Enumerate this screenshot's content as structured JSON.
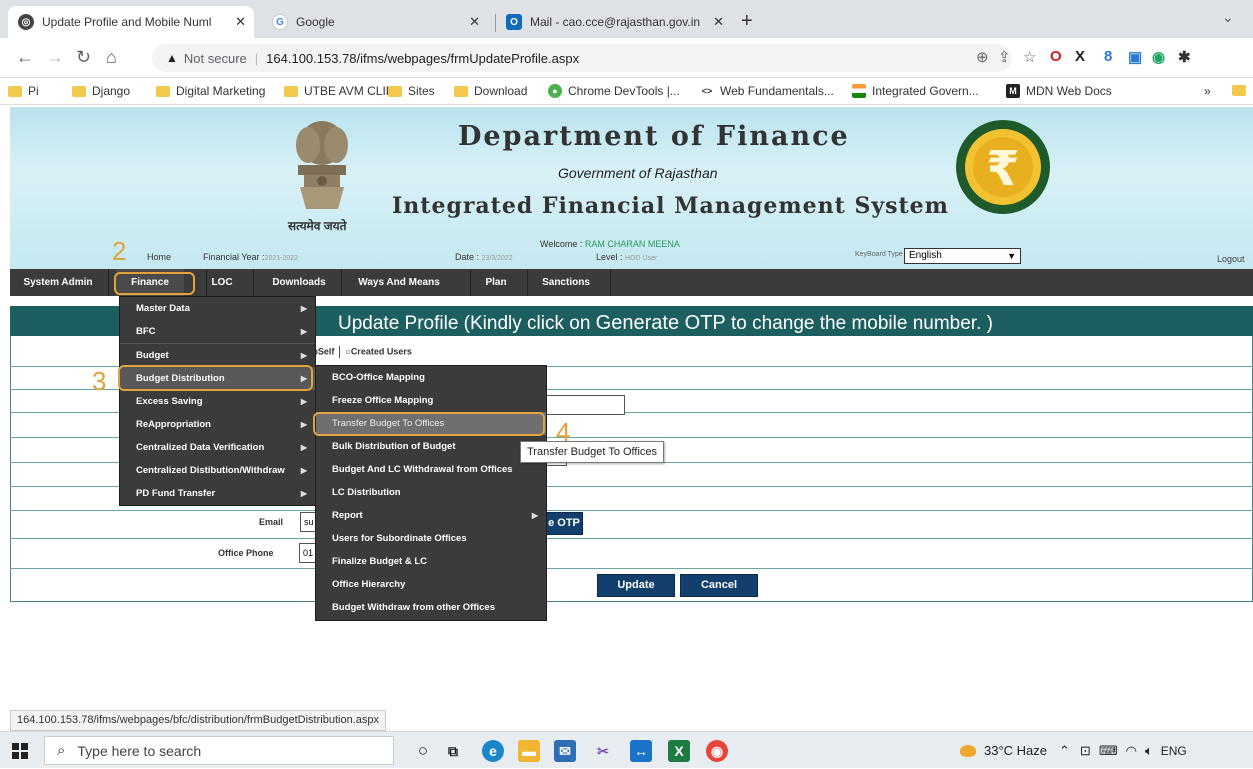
{
  "browser": {
    "tabs": [
      {
        "title": "Update Profile and Mobile Numl",
        "active": true
      },
      {
        "title": "Google",
        "active": false
      },
      {
        "title": "Mail - cao.cce@rajasthan.gov.in",
        "active": false
      }
    ],
    "url": "164.100.153.78/ifms/webpages/frmUpdateProfile.aspx",
    "security_label": "Not secure",
    "bookmarks": [
      "Pi",
      "Django",
      "Digital Marketing",
      "UTBE AVM CLIP",
      "Sites",
      "Download",
      "Chrome DevTools |...",
      "Web Fundamentals...",
      "Integrated Govern...",
      "MDN Web Docs"
    ],
    "bookmarks_more": "»",
    "status_url": "164.100.153.78/ifms/webpages/bfc/distribution/frmBudgetDistribution.aspx"
  },
  "header": {
    "title": "Department of Finance",
    "subtitle": "Government of Rajasthan",
    "system_name": "Integrated Financial Management System",
    "emblem_motto": "सत्यमेव जयते",
    "welcome_label": "Welcome :",
    "welcome_user": "RAM CHARAN MEENA",
    "home_label": "Home",
    "fy_label": "Financial Year :",
    "fy_value": "2021-2022",
    "date_label": "Date :",
    "date_value": "23/3/2022",
    "level_label": "Level :",
    "level_value": "HOD User",
    "keyboard_label": "KeyBoard Type :",
    "keyboard_value": "English",
    "logout": "Logout"
  },
  "nav": {
    "items": [
      "System Admin",
      "Finance",
      "LOC",
      "Downloads",
      "Ways And Means",
      "Plan",
      "Sanctions"
    ]
  },
  "finance_menu": {
    "items": [
      "Master Data",
      "BFC",
      "Budget",
      "Budget Distribution",
      "Excess Saving",
      "ReAppropriation",
      "Centralized Data Verification",
      "Centralized Distibution/Withdraw",
      "PD Fund Transfer"
    ]
  },
  "budget_dist_menu": {
    "items": [
      "BCO-Office Mapping",
      "Freeze Office Mapping",
      "Transfer Budget To Offices",
      "Bulk Distribution of Budget",
      "Budget And LC Withdrawal from Offices",
      "LC Distribution",
      "Report",
      "Users for Subordinate Offices",
      "Finalize Budget & LC",
      "Office Hierarchy",
      "Budget Withdraw from other Offices"
    ]
  },
  "tooltip": "Transfer Budget To Offices",
  "annotations": {
    "step2": "2",
    "step3": "3",
    "step4": "4"
  },
  "form": {
    "heading_prefix": "Update Profile (Kindly click on ",
    "heading_emph": "Generate OTP",
    "heading_suffix": " to change the mobile number. )",
    "radio_self": "Self",
    "radio_created": "Created Users",
    "email_label": "Email",
    "email_value": "su",
    "phone_label": "Office Phone",
    "phone_value": "01",
    "otp_button": "e OTP",
    "update_button": "Update",
    "cancel_button": "Cancel"
  },
  "taskbar": {
    "search_placeholder": "Type here to search",
    "weather": "33°C Haze",
    "lang": "ENG"
  },
  "colors": {
    "nav_bg": "#3b3b3b",
    "teal": "#1d5e60",
    "highlight": "#e2a33b",
    "button": "#123f6b"
  }
}
